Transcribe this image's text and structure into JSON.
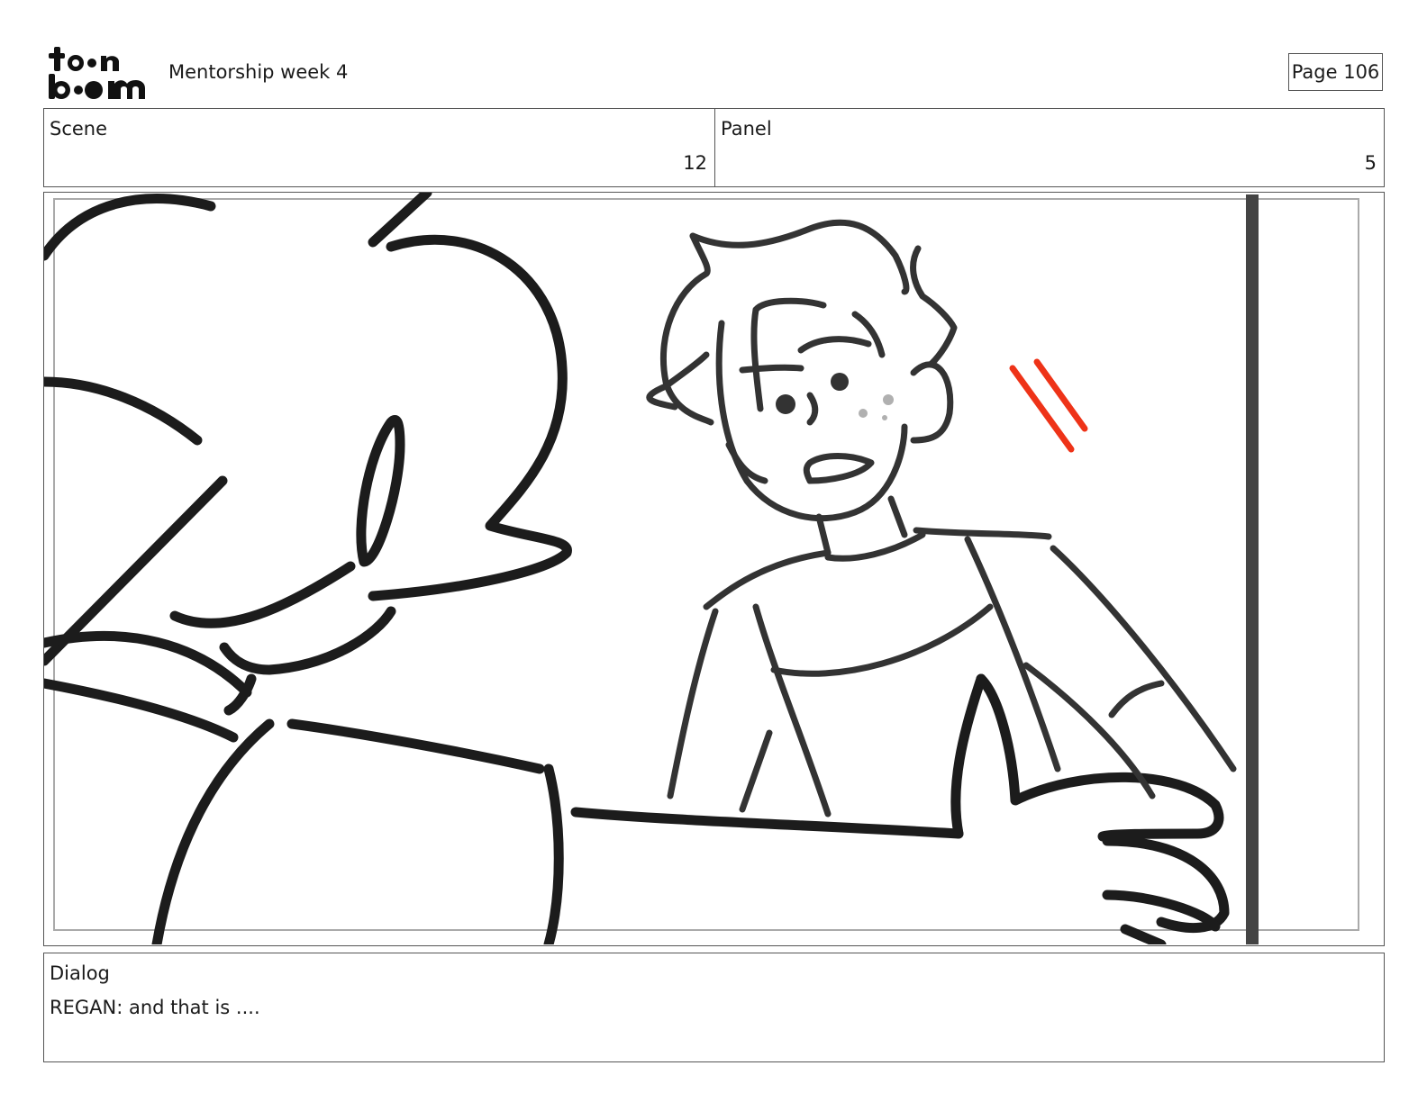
{
  "header": {
    "logo_text_top": "to•n",
    "logo_text_bottom": "b••m",
    "title": "Mentorship week 4",
    "page_label": "Page 106"
  },
  "scene": {
    "label": "Scene",
    "value": "12"
  },
  "panel": {
    "label": "Panel",
    "value": "5"
  },
  "dialog": {
    "label": "Dialog",
    "text": "REGAN: and that is ...."
  }
}
